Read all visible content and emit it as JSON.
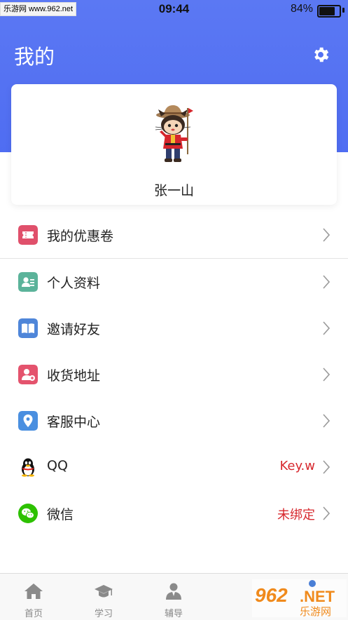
{
  "status_bar": {
    "watermark_text": "乐游网 www.962.net",
    "time": "09:44",
    "battery_percent": "84%",
    "battery_level": 0.84
  },
  "header": {
    "title": "我的",
    "settings_icon": "gear-icon",
    "background_color": "#5370f2"
  },
  "profile": {
    "username": "张一山",
    "avatar": "cartoon-avatar"
  },
  "menu": [
    {
      "label": "我的优惠卷",
      "icon": "coupon-icon",
      "value": ""
    },
    {
      "label": "个人资料",
      "icon": "profile-card-icon",
      "value": ""
    },
    {
      "label": "邀请好友",
      "icon": "book-icon",
      "value": ""
    },
    {
      "label": "收货地址",
      "icon": "user-add-icon",
      "value": ""
    },
    {
      "label": "客服中心",
      "icon": "location-pin-icon",
      "value": ""
    },
    {
      "label": "QQ",
      "icon": "qq-penguin-icon",
      "value": "Key.w"
    },
    {
      "label": "微信",
      "icon": "wechat-icon",
      "value": "未绑定"
    }
  ],
  "tabbar": [
    {
      "label": "首页",
      "icon": "home-icon"
    },
    {
      "label": "学习",
      "icon": "graduation-cap-icon"
    },
    {
      "label": "辅导",
      "icon": "tutor-icon"
    }
  ],
  "watermark_logo": {
    "number": "962",
    "suffix": ".NET",
    "chinese": "乐游网"
  },
  "colors": {
    "accent_red": "#d7282e",
    "coupon": "#e0506b",
    "profile": "#5bb39a",
    "book": "#4f86d9",
    "address": "#e4536d",
    "service": "#4a8fe0",
    "wechat": "#2dc100"
  }
}
